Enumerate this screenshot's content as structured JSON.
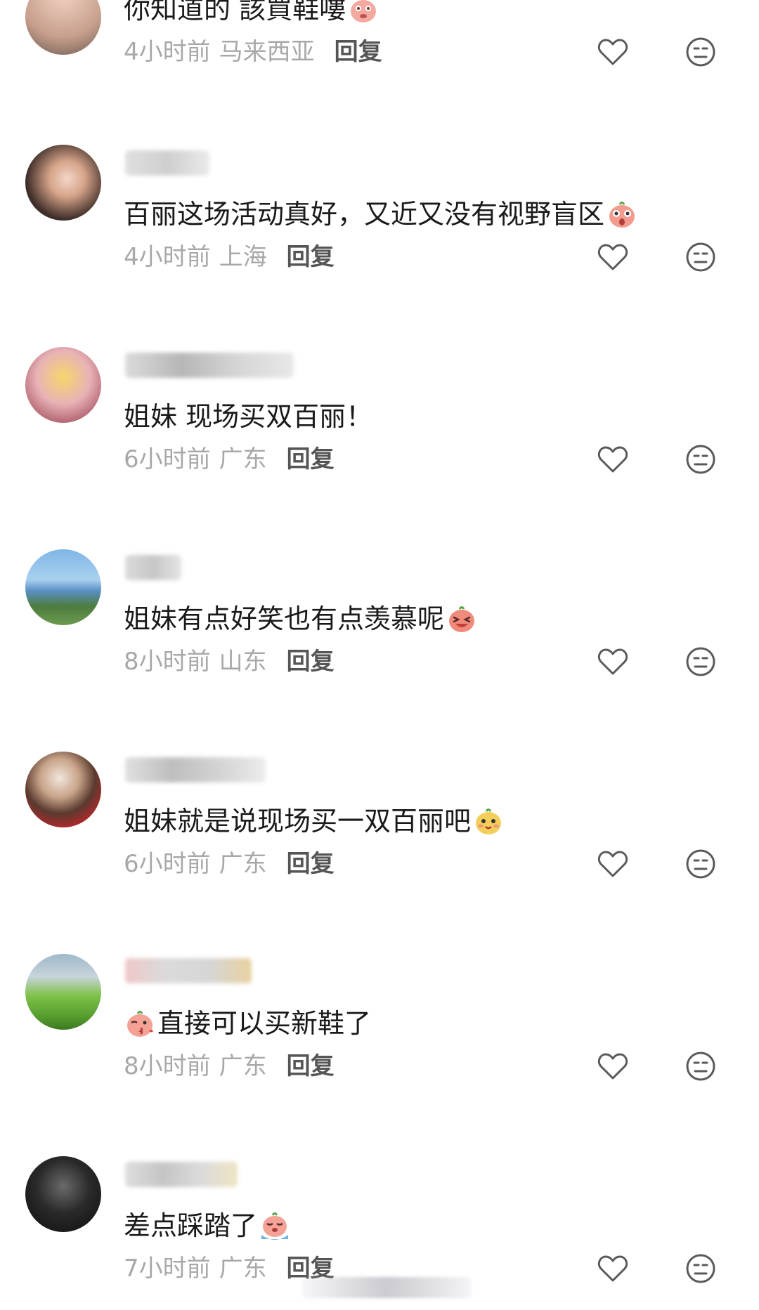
{
  "comments": [
    {
      "text": "你知道的 該買鞋嘍",
      "time": "4小时前",
      "location": "马来西亚",
      "reply": "回复",
      "emoji": "pink-blush-emoji"
    },
    {
      "text": "百丽这场活动真好，又近又没有视野盲区",
      "time": "4小时前",
      "location": "上海",
      "reply": "回复",
      "emoji": "pink-shocked-emoji"
    },
    {
      "text": "姐妹 现场买双百丽！",
      "time": "6小时前",
      "location": "广东",
      "reply": "回复"
    },
    {
      "text": "姐妹有点好笑也有点羡慕呢",
      "time": "8小时前",
      "location": "山东",
      "reply": "回复",
      "emoji": "laughing-emoji"
    },
    {
      "text": "姐妹就是说现场买一双百丽吧",
      "time": "6小时前",
      "location": "广东",
      "reply": "回复",
      "emoji": "yellow-cute-emoji"
    },
    {
      "text": "直接可以买新鞋了",
      "time": "8小时前",
      "location": "广东",
      "reply": "回复",
      "emoji": "kiss-emoji"
    },
    {
      "text": "差点踩踏了",
      "time": "7小时前",
      "location": "广东",
      "reply": "回复",
      "emoji": "crying-emoji"
    }
  ],
  "icons": {
    "like": "heart-outline-icon",
    "dislike": "neutral-face-icon"
  },
  "colors": {
    "text": "#1a1a1a",
    "meta": "#a8a8a8",
    "reply": "#555555",
    "icon": "#5a5a5a",
    "background": "#ffffff"
  }
}
